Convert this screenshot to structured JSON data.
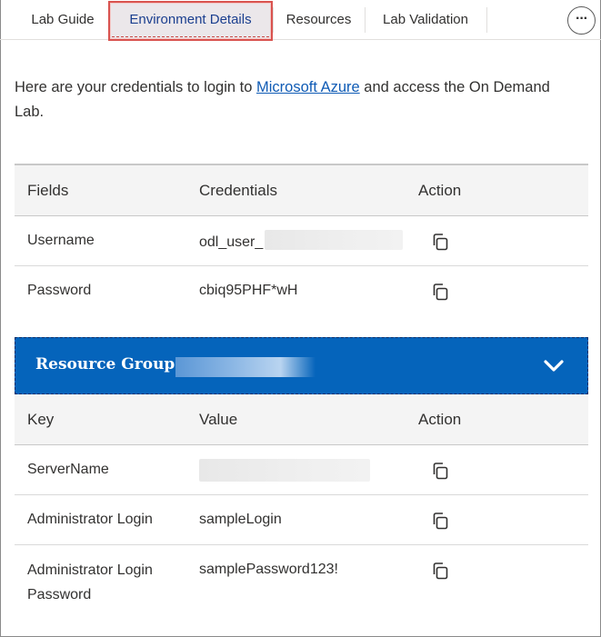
{
  "tabs": [
    {
      "label": "Lab Guide"
    },
    {
      "label": "Environment Details"
    },
    {
      "label": "Resources"
    },
    {
      "label": "Lab Validation"
    }
  ],
  "more_button": {
    "label": "···"
  },
  "intro": {
    "before_link": "Here are your credentials to login to ",
    "link_text": "Microsoft Azure",
    "after_link": " and access the On Demand Lab."
  },
  "credentials_table": {
    "headers": [
      "Fields",
      "Credentials",
      "Action"
    ],
    "rows": [
      {
        "field": "Username",
        "value": "odl_user_"
      },
      {
        "field": "Password",
        "value": "cbiq95PHF*wH"
      }
    ]
  },
  "resource_group": {
    "title": "Resource Group :"
  },
  "rg_table": {
    "headers": [
      "Key",
      "Value",
      "Action"
    ],
    "rows": [
      {
        "key": "ServerName",
        "value": ""
      },
      {
        "key": "Administrator Login",
        "value": "sampleLogin"
      },
      {
        "key": "Administrator Login Password",
        "value": "samplePassword123!"
      }
    ]
  },
  "icons": {
    "copy": "copy-icon",
    "expand": "chevron-down-icon",
    "more": "ellipsis-icon"
  },
  "colors": {
    "banner": "#0564bb",
    "link": "#0f5bb5",
    "active_tab_outline": "#d9534f"
  }
}
